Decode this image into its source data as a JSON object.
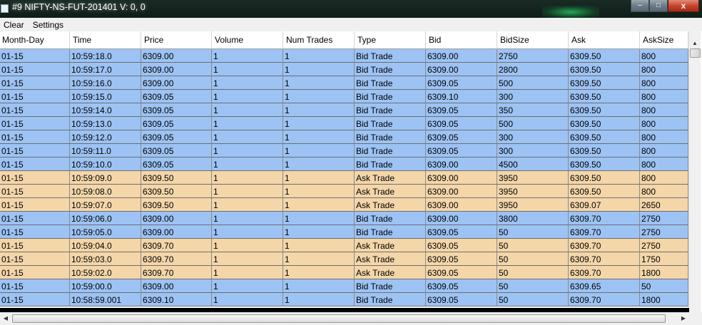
{
  "window": {
    "title": "#9 NIFTY-NS-FUT-201401  V: 0, 0",
    "minimize_label": "–",
    "maximize_label": "□",
    "close_label": "x"
  },
  "menu": {
    "items": [
      "Clear",
      "Settings"
    ]
  },
  "table": {
    "columns": [
      "Month-Day",
      "Time",
      "Price",
      "Volume",
      "Num Trades",
      "Type",
      "Bid",
      "BidSize",
      "Ask",
      "AskSize"
    ],
    "rows": [
      {
        "kind": "bid",
        "cells": [
          "01-15",
          "10:59:18.0",
          "6309.00",
          "1",
          "1",
          "Bid Trade",
          "6309.00",
          "2750",
          "6309.50",
          "800"
        ]
      },
      {
        "kind": "bid",
        "cells": [
          "01-15",
          "10:59:17.0",
          "6309.00",
          "1",
          "1",
          "Bid Trade",
          "6309.00",
          "2800",
          "6309.50",
          "800"
        ]
      },
      {
        "kind": "bid",
        "cells": [
          "01-15",
          "10:59:16.0",
          "6309.00",
          "1",
          "1",
          "Bid Trade",
          "6309.05",
          "500",
          "6309.50",
          "800"
        ]
      },
      {
        "kind": "bid",
        "cells": [
          "01-15",
          "10:59:15.0",
          "6309.05",
          "1",
          "1",
          "Bid Trade",
          "6309.10",
          "300",
          "6309.50",
          "800"
        ]
      },
      {
        "kind": "bid",
        "cells": [
          "01-15",
          "10:59:14.0",
          "6309.05",
          "1",
          "1",
          "Bid Trade",
          "6309.05",
          "350",
          "6309.50",
          "800"
        ]
      },
      {
        "kind": "bid",
        "cells": [
          "01-15",
          "10:59:13.0",
          "6309.05",
          "1",
          "1",
          "Bid Trade",
          "6309.05",
          "500",
          "6309.50",
          "800"
        ]
      },
      {
        "kind": "bid",
        "cells": [
          "01-15",
          "10:59:12.0",
          "6309.05",
          "1",
          "1",
          "Bid Trade",
          "6309.05",
          "300",
          "6309.50",
          "800"
        ]
      },
      {
        "kind": "bid",
        "cells": [
          "01-15",
          "10:59:11.0",
          "6309.05",
          "1",
          "1",
          "Bid Trade",
          "6309.05",
          "300",
          "6309.50",
          "800"
        ]
      },
      {
        "kind": "bid",
        "cells": [
          "01-15",
          "10:59:10.0",
          "6309.05",
          "1",
          "1",
          "Bid Trade",
          "6309.00",
          "4500",
          "6309.50",
          "800"
        ]
      },
      {
        "kind": "ask",
        "cells": [
          "01-15",
          "10:59:09.0",
          "6309.50",
          "1",
          "1",
          "Ask Trade",
          "6309.00",
          "3950",
          "6309.50",
          "800"
        ]
      },
      {
        "kind": "ask",
        "cells": [
          "01-15",
          "10:59:08.0",
          "6309.50",
          "1",
          "1",
          "Ask Trade",
          "6309.00",
          "3950",
          "6309.50",
          "800"
        ]
      },
      {
        "kind": "ask",
        "cells": [
          "01-15",
          "10:59:07.0",
          "6309.50",
          "1",
          "1",
          "Ask Trade",
          "6309.00",
          "3950",
          "6309.07",
          "2650"
        ]
      },
      {
        "kind": "bid",
        "cells": [
          "01-15",
          "10:59:06.0",
          "6309.00",
          "1",
          "1",
          "Bid Trade",
          "6309.00",
          "3800",
          "6309.70",
          "2750"
        ]
      },
      {
        "kind": "bid",
        "cells": [
          "01-15",
          "10:59:05.0",
          "6309.00",
          "1",
          "1",
          "Bid Trade",
          "6309.05",
          "50",
          "6309.70",
          "2750"
        ]
      },
      {
        "kind": "ask",
        "cells": [
          "01-15",
          "10:59:04.0",
          "6309.70",
          "1",
          "1",
          "Ask Trade",
          "6309.05",
          "50",
          "6309.70",
          "2750"
        ]
      },
      {
        "kind": "ask",
        "cells": [
          "01-15",
          "10:59:03.0",
          "6309.70",
          "1",
          "1",
          "Ask Trade",
          "6309.05",
          "50",
          "6309.70",
          "1750"
        ]
      },
      {
        "kind": "ask",
        "cells": [
          "01-15",
          "10:59:02.0",
          "6309.70",
          "1",
          "1",
          "Ask Trade",
          "6309.05",
          "50",
          "6309.70",
          "1800"
        ]
      },
      {
        "kind": "bid",
        "cells": [
          "01-15",
          "10:59:00.0",
          "6309.00",
          "1",
          "1",
          "Bid Trade",
          "6309.05",
          "50",
          "6309.65",
          "50"
        ]
      },
      {
        "kind": "bid",
        "cells": [
          "01-15",
          "10:58:59.001",
          "6309.10",
          "1",
          "1",
          "Bid Trade",
          "6309.05",
          "50",
          "6309.70",
          "1800"
        ]
      }
    ]
  },
  "colors": {
    "bid_row": "#9dc3f4",
    "ask_row": "#f4d6a9"
  },
  "scrollbars": {
    "up_arrow": "▲",
    "down_arrow": "▼",
    "left_arrow": "◀",
    "right_arrow": "▶"
  }
}
